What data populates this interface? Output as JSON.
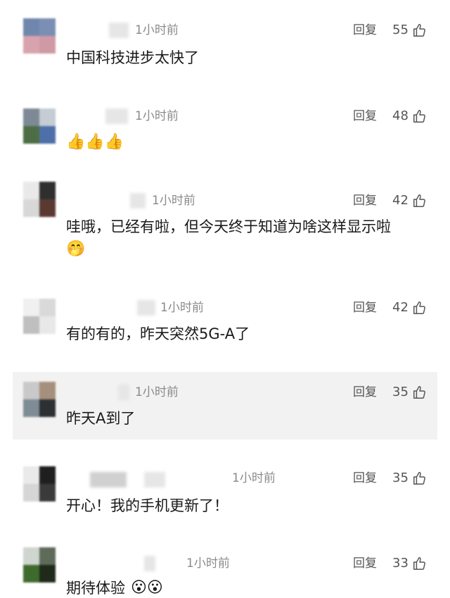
{
  "comments": [
    {
      "time": "1小时前",
      "reply_label": "回复",
      "likes": "55",
      "text": "中国科技进步太快了",
      "emoji": ""
    },
    {
      "time": "1小时前",
      "reply_label": "回复",
      "likes": "48",
      "text": "",
      "emoji": "👍👍👍"
    },
    {
      "time": "1小时前",
      "reply_label": "回复",
      "likes": "42",
      "text": "哇哦，已经有啦，但今天终于知道为啥这样显示啦",
      "emoji": "🤭"
    },
    {
      "time": "1小时前",
      "reply_label": "回复",
      "likes": "42",
      "text": "有的有的，昨天突然5G-A了",
      "emoji": ""
    },
    {
      "time": "1小时前",
      "reply_label": "回复",
      "likes": "35",
      "text": "昨天A到了",
      "emoji": ""
    },
    {
      "time": "1小时前",
      "reply_label": "回复",
      "likes": "35",
      "text": "开心！我的手机更新了！",
      "emoji": ""
    },
    {
      "time": "1小时前",
      "reply_label": "回复",
      "likes": "33",
      "text": "期待体验",
      "emoji": "😮😮"
    }
  ],
  "icons": {
    "like": "thumbs-up-icon"
  },
  "colors": {
    "text": "#1a1a1a",
    "meta": "#8a8a8a",
    "highlight_bg": "#f2f2f2"
  }
}
